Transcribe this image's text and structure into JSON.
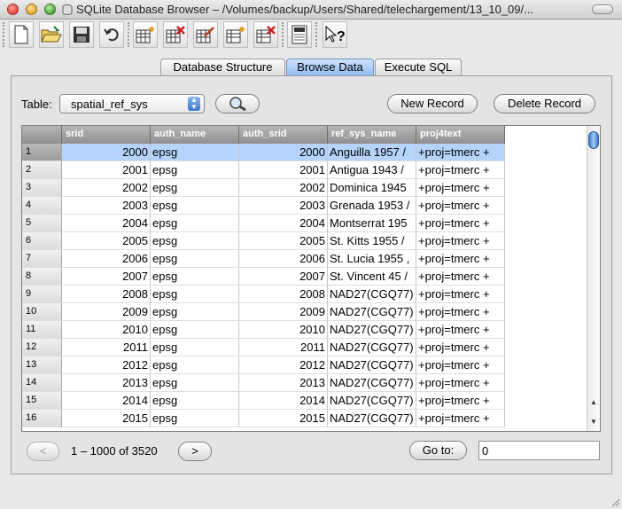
{
  "window": {
    "title": "SQLite Database Browser – /Volumes/backup/Users/Shared/telechargement/13_10_09/..."
  },
  "toolbar": {
    "buttons": [
      {
        "name": "new-database-icon"
      },
      {
        "name": "open-database-icon"
      },
      {
        "name": "save-database-icon"
      },
      {
        "name": "revert-changes-icon"
      },
      {
        "name": "create-table-icon"
      },
      {
        "name": "delete-table-icon"
      },
      {
        "name": "modify-table-icon"
      },
      {
        "name": "create-index-icon"
      },
      {
        "name": "delete-index-icon"
      },
      {
        "name": "sql-log-icon"
      },
      {
        "name": "whats-this-help-icon"
      }
    ]
  },
  "tabs": [
    {
      "label": "Database Structure",
      "active": false
    },
    {
      "label": "Browse Data",
      "active": true
    },
    {
      "label": "Execute SQL",
      "active": false
    }
  ],
  "browse": {
    "table_label": "Table:",
    "table_selected": "spatial_ref_sys",
    "new_record_label": "New Record",
    "delete_record_label": "Delete Record",
    "columns": [
      "srid",
      "auth_name",
      "auth_srid",
      "ref_sys_name",
      "proj4text"
    ],
    "rows": [
      {
        "n": "1",
        "srid": "2000",
        "auth_name": "epsg",
        "auth_srid": "2000",
        "ref_sys_name": "Anguilla 1957 /",
        "proj4text": "+proj=tmerc +"
      },
      {
        "n": "2",
        "srid": "2001",
        "auth_name": "epsg",
        "auth_srid": "2001",
        "ref_sys_name": "Antigua 1943 /",
        "proj4text": "+proj=tmerc +"
      },
      {
        "n": "3",
        "srid": "2002",
        "auth_name": "epsg",
        "auth_srid": "2002",
        "ref_sys_name": "Dominica 1945",
        "proj4text": "+proj=tmerc +"
      },
      {
        "n": "4",
        "srid": "2003",
        "auth_name": "epsg",
        "auth_srid": "2003",
        "ref_sys_name": "Grenada 1953 /",
        "proj4text": "+proj=tmerc +"
      },
      {
        "n": "5",
        "srid": "2004",
        "auth_name": "epsg",
        "auth_srid": "2004",
        "ref_sys_name": "Montserrat 195",
        "proj4text": "+proj=tmerc +"
      },
      {
        "n": "6",
        "srid": "2005",
        "auth_name": "epsg",
        "auth_srid": "2005",
        "ref_sys_name": "St. Kitts 1955 /",
        "proj4text": "+proj=tmerc +"
      },
      {
        "n": "7",
        "srid": "2006",
        "auth_name": "epsg",
        "auth_srid": "2006",
        "ref_sys_name": "St. Lucia 1955 ,",
        "proj4text": "+proj=tmerc +"
      },
      {
        "n": "8",
        "srid": "2007",
        "auth_name": "epsg",
        "auth_srid": "2007",
        "ref_sys_name": "St. Vincent 45 /",
        "proj4text": "+proj=tmerc +"
      },
      {
        "n": "9",
        "srid": "2008",
        "auth_name": "epsg",
        "auth_srid": "2008",
        "ref_sys_name": "NAD27(CGQ77)",
        "proj4text": "+proj=tmerc +"
      },
      {
        "n": "10",
        "srid": "2009",
        "auth_name": "epsg",
        "auth_srid": "2009",
        "ref_sys_name": "NAD27(CGQ77)",
        "proj4text": "+proj=tmerc +"
      },
      {
        "n": "11",
        "srid": "2010",
        "auth_name": "epsg",
        "auth_srid": "2010",
        "ref_sys_name": "NAD27(CGQ77)",
        "proj4text": "+proj=tmerc +"
      },
      {
        "n": "12",
        "srid": "2011",
        "auth_name": "epsg",
        "auth_srid": "2011",
        "ref_sys_name": "NAD27(CGQ77)",
        "proj4text": "+proj=tmerc +"
      },
      {
        "n": "13",
        "srid": "2012",
        "auth_name": "epsg",
        "auth_srid": "2012",
        "ref_sys_name": "NAD27(CGQ77)",
        "proj4text": "+proj=tmerc +"
      },
      {
        "n": "14",
        "srid": "2013",
        "auth_name": "epsg",
        "auth_srid": "2013",
        "ref_sys_name": "NAD27(CGQ77)",
        "proj4text": "+proj=tmerc +"
      },
      {
        "n": "15",
        "srid": "2014",
        "auth_name": "epsg",
        "auth_srid": "2014",
        "ref_sys_name": "NAD27(CGQ77)",
        "proj4text": "+proj=tmerc +"
      },
      {
        "n": "16",
        "srid": "2015",
        "auth_name": "epsg",
        "auth_srid": "2015",
        "ref_sys_name": "NAD27(CGQ77)",
        "proj4text": "+proj=tmerc +"
      }
    ],
    "selected_row": "1",
    "nav": {
      "prev_label": "<",
      "next_label": ">",
      "range_text": "1 – 1000 of 3520",
      "goto_label": "Go to:",
      "goto_value": "0"
    }
  },
  "colors": {
    "selection": "#b5d3fb",
    "active_tab": "#8fbbef"
  }
}
